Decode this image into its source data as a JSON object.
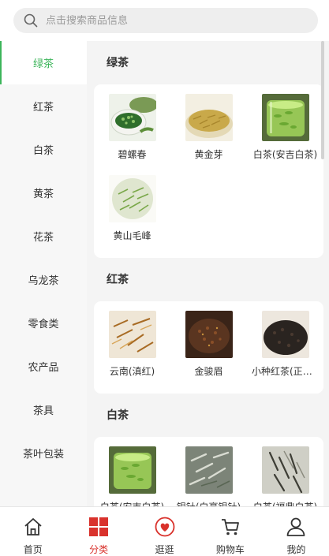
{
  "search": {
    "placeholder": "点击搜索商品信息"
  },
  "sidebar": {
    "items": [
      {
        "label": "绿茶",
        "active": true
      },
      {
        "label": "红茶"
      },
      {
        "label": "白茶"
      },
      {
        "label": "黄茶"
      },
      {
        "label": "花茶"
      },
      {
        "label": "乌龙茶"
      },
      {
        "label": "零食类"
      },
      {
        "label": "农产品"
      },
      {
        "label": "茶具"
      },
      {
        "label": "茶叶包装"
      }
    ]
  },
  "sections": [
    {
      "title": "绿茶",
      "products": [
        {
          "name": "碧螺春",
          "image": "green-tea-in-bowl"
        },
        {
          "name": "黄金芽",
          "image": "golden-bud-leaves"
        },
        {
          "name": "白茶(安吉白茶)",
          "image": "green-tea-in-glass"
        },
        {
          "name": "黄山毛峰",
          "image": "green-needle-leaves"
        }
      ]
    },
    {
      "title": "红茶",
      "products": [
        {
          "name": "云南(滇红)",
          "image": "golden-twisted-leaves"
        },
        {
          "name": "金骏眉",
          "image": "dark-leaves-in-bowl"
        },
        {
          "name": "小种红茶(正山小种)",
          "image": "black-tea-leaves"
        }
      ]
    },
    {
      "title": "白茶",
      "products": [
        {
          "name": "白茶(安吉白茶)",
          "image": "green-tea-in-glass"
        },
        {
          "name": "银针(白毫银针)",
          "image": "silver-needle-leaves"
        },
        {
          "name": "白茶(福鼎白茶)",
          "image": "white-tea-leaves"
        }
      ]
    }
  ],
  "tabbar": [
    {
      "label": "首页",
      "icon": "home-icon"
    },
    {
      "label": "分类",
      "icon": "category-icon",
      "active": true
    },
    {
      "label": "逛逛",
      "icon": "heart-icon"
    },
    {
      "label": "购物车",
      "icon": "cart-icon"
    },
    {
      "label": "我的",
      "icon": "user-icon"
    }
  ],
  "colors": {
    "accent_green": "#3cb55a",
    "accent_red": "#d9322c"
  }
}
